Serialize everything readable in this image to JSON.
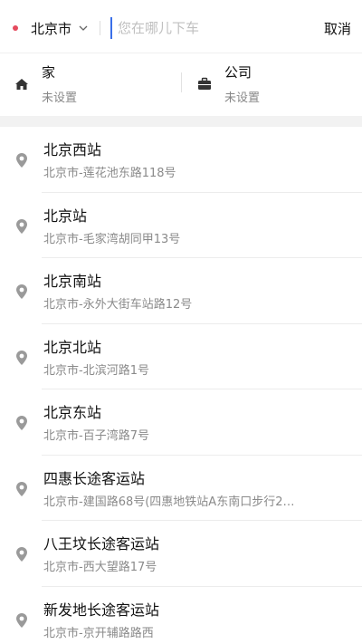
{
  "search": {
    "city": "北京市",
    "placeholder": "您在哪儿下车",
    "cancel_label": "取消"
  },
  "shortcuts": {
    "home": {
      "title": "家",
      "subtitle": "未设置"
    },
    "company": {
      "title": "公司",
      "subtitle": "未设置"
    }
  },
  "results": [
    {
      "title": "北京西站",
      "address": "北京市-莲花池东路118号"
    },
    {
      "title": "北京站",
      "address": "北京市-毛家湾胡同甲13号"
    },
    {
      "title": "北京南站",
      "address": "北京市-永外大街车站路12号"
    },
    {
      "title": "北京北站",
      "address": "北京市-北滨河路1号"
    },
    {
      "title": "北京东站",
      "address": "北京市-百子湾路7号"
    },
    {
      "title": "四惠长途客运站",
      "address": "北京市-建国路68号(四惠地铁站A东南口步行2…"
    },
    {
      "title": "八王坟长途客运站",
      "address": "北京市-西大望路17号"
    },
    {
      "title": "新发地长途客运站",
      "address": "北京市-京开辅路路西"
    }
  ],
  "icons": {
    "city_dot": "location-dot-icon",
    "chevron": "chevron-down-icon",
    "home": "home-icon",
    "company": "briefcase-icon",
    "pin": "map-pin-icon"
  },
  "colors": {
    "accent_dot": "#e54a5e",
    "cursor": "#3a6fe8"
  }
}
